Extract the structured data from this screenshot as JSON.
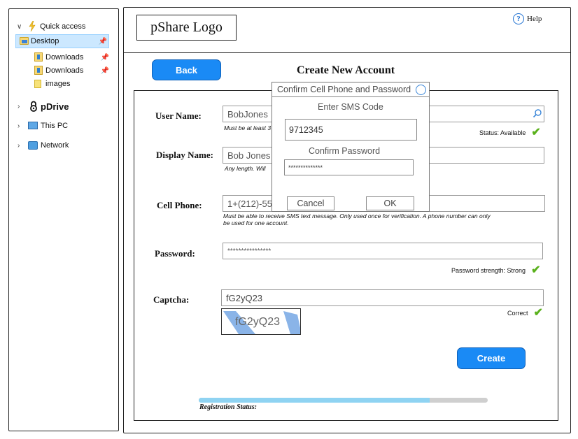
{
  "sidebar": {
    "quick_access": "Quick access",
    "items": [
      {
        "label": "Desktop",
        "pinned": true,
        "icon": "desktop-folder-icon"
      },
      {
        "label": "Downloads",
        "pinned": true,
        "icon": "downloads-folder-icon"
      },
      {
        "label": "Downloads",
        "pinned": true,
        "icon": "downloads-folder-icon"
      },
      {
        "label": "images",
        "pinned": false,
        "icon": "folder-icon"
      }
    ],
    "pdrive": "pDrive",
    "this_pc": "This PC",
    "network": "Network"
  },
  "header": {
    "logo": "pShare Logo",
    "help": "Help",
    "help_glyph": "?"
  },
  "page": {
    "back": "Back",
    "title": "Create New Account",
    "create": "Create"
  },
  "form": {
    "username": {
      "label": "User Name:",
      "value": "BobJones",
      "hint": "Must be at least 3",
      "status": "Status: Available"
    },
    "display_name": {
      "label": "Display Name:",
      "value": "Bob Jones",
      "hint": "Any length.  Will"
    },
    "cell_phone": {
      "label": "Cell Phone:",
      "value": "1+(212)-55",
      "hint_line1": "Must be able to receive SMS text message.  Only used once for verification.  A phone number can only",
      "hint_line2": "be used for one account."
    },
    "password": {
      "label": "Password:",
      "value": "****************",
      "status": "Password strength: Strong"
    },
    "captcha": {
      "label": "Captcha:",
      "value": "fG2yQ23",
      "image_text": "fG2yQ23",
      "status": "Correct"
    }
  },
  "dialog": {
    "title": "Confirm Cell Phone and Password",
    "sms_label": "Enter SMS Code",
    "sms_value": "9712345",
    "confirm_label": "Confirm Password",
    "confirm_value": "**************",
    "cancel": "Cancel",
    "ok": "OK"
  },
  "registration": {
    "label": "Registration Status:",
    "progress": 0.8
  },
  "colors": {
    "accent": "#1a8af5",
    "check": "#5ab11c",
    "progress_fill": "#8fd3f2",
    "selected_bg": "#cce8ff"
  }
}
